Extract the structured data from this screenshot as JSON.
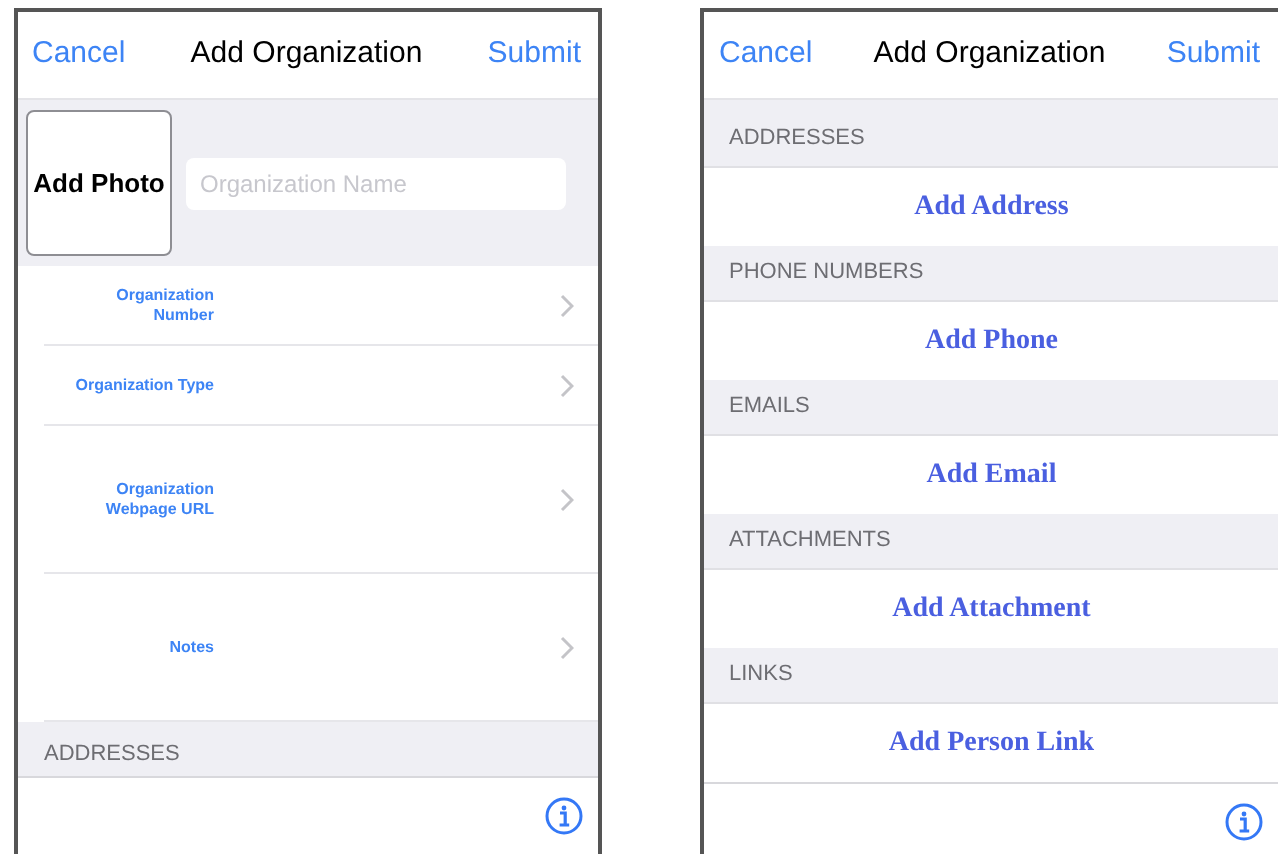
{
  "left_screen": {
    "nav": {
      "cancel": "Cancel",
      "title": "Add Organization",
      "submit": "Submit"
    },
    "photo_button": "Add Photo",
    "name_field": {
      "placeholder": "Organization Name"
    },
    "rows": [
      {
        "label_lines": [
          "Organization",
          "Number"
        ],
        "kind": "short"
      },
      {
        "label_lines": [
          "Organization Type"
        ],
        "kind": "short"
      },
      {
        "label_lines": [
          "Organization",
          "Webpage URL"
        ],
        "kind": "tall"
      },
      {
        "label_lines": [
          "Notes"
        ],
        "kind": "tall"
      }
    ],
    "section_header": "ADDRESSES"
  },
  "right_screen": {
    "nav": {
      "cancel": "Cancel",
      "title": "Add Organization",
      "submit": "Submit"
    },
    "sections": [
      {
        "header": "ADDRESSES",
        "action": "Add Address"
      },
      {
        "header": "PHONE NUMBERS",
        "action": "Add Phone"
      },
      {
        "header": "EMAILS",
        "action": "Add Email"
      },
      {
        "header": "ATTACHMENTS",
        "action": "Add Attachment"
      },
      {
        "header": "LINKS",
        "action": "Add Person Link"
      }
    ]
  }
}
